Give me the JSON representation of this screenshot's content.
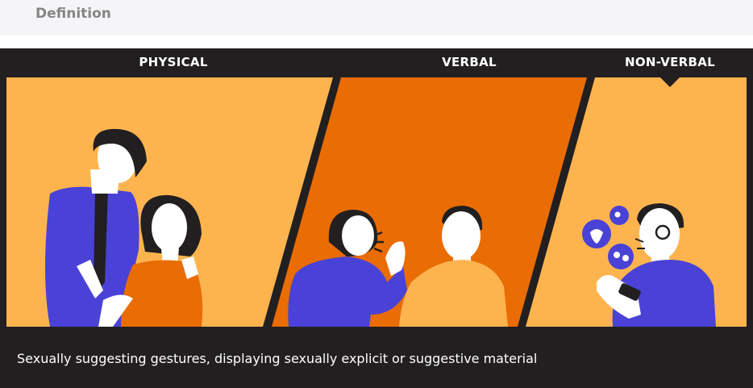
{
  "header": {
    "title": "Definition"
  },
  "tabs": [
    {
      "label": "PHYSICAL"
    },
    {
      "label": "VERBAL"
    },
    {
      "label": "NON-VERBAL"
    }
  ],
  "selected_tab": "NON-VERBAL",
  "colors": {
    "panel_light": "#fdb44f",
    "panel_dark": "#e96c04",
    "figure_blue": "#4a42d6",
    "dark": "#221f20"
  },
  "description": "Sexually suggesting gestures, displaying sexually explicit or suggestive material"
}
